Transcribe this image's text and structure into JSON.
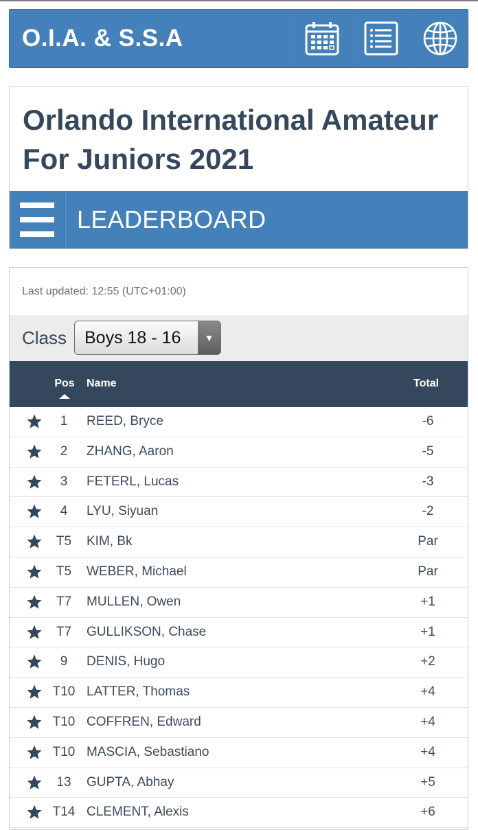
{
  "header": {
    "brand": "O.I.A. & S.S.A",
    "icons": [
      "calendar-icon",
      "list-icon",
      "globe-icon"
    ]
  },
  "event": {
    "title": "Orlando International Amateur For Juniors 2021",
    "section": "LEADERBOARD"
  },
  "leaderboard": {
    "last_updated": "Last updated: 12:55 (UTC+01:00)",
    "class_label": "Class",
    "class_selected": "Boys 18 - 16",
    "columns": {
      "pos": "Pos",
      "name": "Name",
      "total": "Total"
    },
    "rows": [
      {
        "pos": "1",
        "name": "REED, Bryce",
        "total": "-6"
      },
      {
        "pos": "2",
        "name": "ZHANG, Aaron",
        "total": "-5"
      },
      {
        "pos": "3",
        "name": "FETERL, Lucas",
        "total": "-3"
      },
      {
        "pos": "4",
        "name": "LYU, Siyuan",
        "total": "-2"
      },
      {
        "pos": "T5",
        "name": "KIM, Bk",
        "total": "Par"
      },
      {
        "pos": "T5",
        "name": "WEBER, Michael",
        "total": "Par"
      },
      {
        "pos": "T7",
        "name": "MULLEN, Owen",
        "total": "+1"
      },
      {
        "pos": "T7",
        "name": "GULLIKSON, Chase",
        "total": "+1"
      },
      {
        "pos": "9",
        "name": "DENIS, Hugo",
        "total": "+2"
      },
      {
        "pos": "T10",
        "name": "LATTER, Thomas",
        "total": "+4"
      },
      {
        "pos": "T10",
        "name": "COFFREN, Edward",
        "total": "+4"
      },
      {
        "pos": "T10",
        "name": "MASCIA, Sebastiano",
        "total": "+4"
      },
      {
        "pos": "13",
        "name": "GUPTA, Abhay",
        "total": "+5"
      },
      {
        "pos": "T14",
        "name": "CLEMENT, Alexis",
        "total": "+6"
      }
    ]
  },
  "colors": {
    "brand_blue": "#4481ba",
    "header_dark": "#34475c",
    "text": "#3a4a5e"
  }
}
